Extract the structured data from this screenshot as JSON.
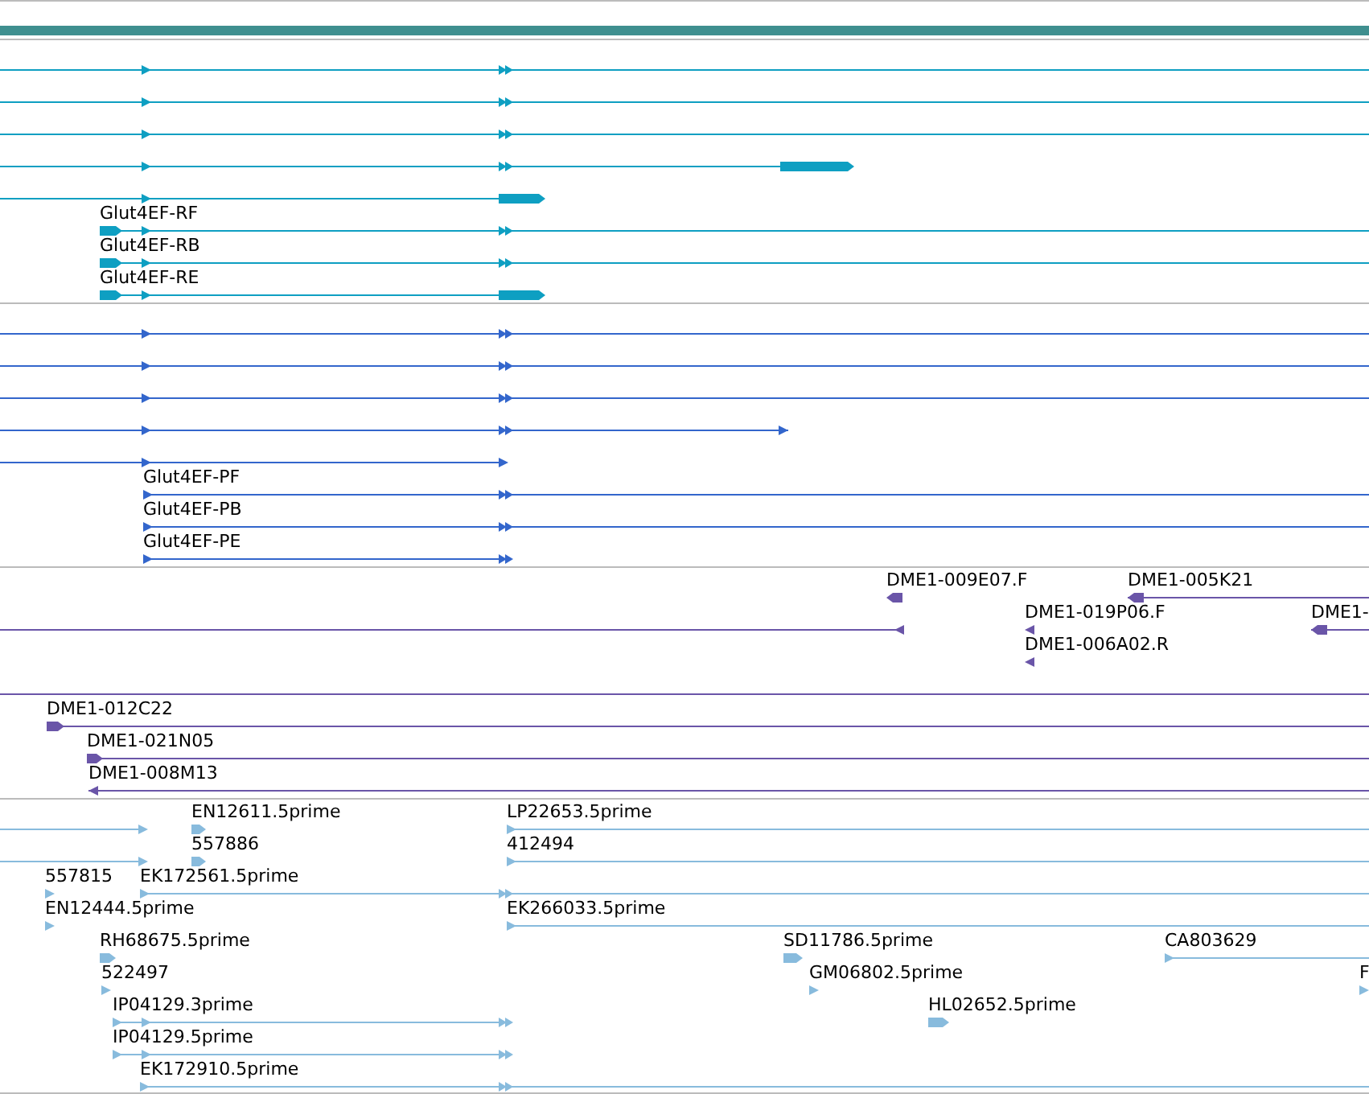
{
  "tracks": [
    {
      "color": "#0e9fc2",
      "features": [
        {
          "label": "Glut4EF-RF"
        },
        {
          "label": "Glut4EF-RB"
        },
        {
          "label": "Glut4EF-RE"
        }
      ]
    },
    {
      "color": "#3366cc",
      "features": [
        {
          "label": "Glut4EF-PF"
        },
        {
          "label": "Glut4EF-PB"
        },
        {
          "label": "Glut4EF-PE"
        }
      ]
    },
    {
      "color": "#6a55a8",
      "features": [
        {
          "label": "DME1-009E07.F"
        },
        {
          "label": "DME1-005K21"
        },
        {
          "label": "DME1-019P06.F"
        },
        {
          "label": "DME1-"
        },
        {
          "label": "DME1-006A02.R"
        },
        {
          "label": "DME1-012C22"
        },
        {
          "label": "DME1-021N05"
        },
        {
          "label": "DME1-008M13"
        }
      ]
    },
    {
      "color": "#88bbdd",
      "features": [
        {
          "label": "EN12611.5prime"
        },
        {
          "label": "LP22653.5prime"
        },
        {
          "label": "557886"
        },
        {
          "label": "412494"
        },
        {
          "label": "557815"
        },
        {
          "label": "EK172561.5prime"
        },
        {
          "label": "EN12444.5prime"
        },
        {
          "label": "EK266033.5prime"
        },
        {
          "label": "RH68675.5prime"
        },
        {
          "label": "SD11786.5prime"
        },
        {
          "label": "CA803629"
        },
        {
          "label": "522497"
        },
        {
          "label": "GM06802.5prime"
        },
        {
          "label": "F"
        },
        {
          "label": "IP04129.3prime"
        },
        {
          "label": "HL02652.5prime"
        },
        {
          "label": "IP04129.5prime"
        },
        {
          "label": "EK172910.5prime"
        }
      ]
    }
  ]
}
